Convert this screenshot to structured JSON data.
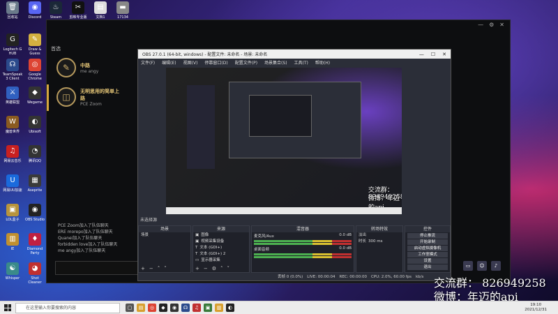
{
  "desktop": {
    "icons": [
      {
        "label": "回收站",
        "glyph": "🗑",
        "color": "#6a7a8a"
      },
      {
        "label": "Discord",
        "glyph": "◉",
        "color": "#5865f2"
      },
      {
        "label": "Steam",
        "glyph": "♨",
        "color": "#1b2838"
      },
      {
        "label": "剪映专业版",
        "glyph": "✂",
        "color": "#111"
      },
      {
        "label": "文档1",
        "glyph": "▤",
        "color": "#ddd"
      },
      {
        "label": "17134",
        "glyph": "▬",
        "color": "#888"
      },
      {
        "label": "Logitech G HUB",
        "glyph": "G",
        "color": "#222"
      },
      {
        "label": "Draw & Guess",
        "glyph": "✎",
        "color": "#d4b040"
      },
      {
        "label": "TeamSpeak 3 Client",
        "glyph": "☊",
        "color": "#2b4a8c"
      },
      {
        "label": "Google Chrome",
        "glyph": "◎",
        "color": "#dd4433"
      },
      {
        "label": "英雄联盟",
        "glyph": "⚔",
        "color": "#3060c0"
      },
      {
        "label": "Wegame",
        "glyph": "◆",
        "color": "#333"
      },
      {
        "label": "魔兽世界",
        "glyph": "W",
        "color": "#8a5a20"
      },
      {
        "label": "Ubisoft",
        "glyph": "◐",
        "color": "#333"
      },
      {
        "label": "网易云音乐",
        "glyph": "♫",
        "color": "#c82020"
      },
      {
        "label": "腾讯QQ",
        "glyph": "◔",
        "color": "#333"
      },
      {
        "label": "网易UU加速",
        "glyph": "U",
        "color": "#1a6adc"
      },
      {
        "label": "Aseprite",
        "glyph": "▦",
        "color": "#3a3a3a"
      },
      {
        "label": "LOL盒子",
        "glyph": "▣",
        "color": "#b8943c"
      },
      {
        "label": "OBS Studio",
        "glyph": "◉",
        "color": "#222"
      },
      {
        "label": "IE",
        "glyph": "▥",
        "color": "#c09030"
      },
      {
        "label": "Diamond Party",
        "glyph": "♦",
        "color": "#c02040"
      },
      {
        "label": "Whisper",
        "glyph": "☯",
        "color": "#3a8a8a"
      },
      {
        "label": "Shot Cleaner",
        "glyph": "◕",
        "color": "#c03030"
      }
    ]
  },
  "app": {
    "title": "首选",
    "controls": [
      "—",
      "⚙",
      "✕"
    ],
    "nav": [
      {
        "title": "中路",
        "subtitle": "me angy",
        "glyph": "✎"
      },
      {
        "title": "无明思用的简单上路",
        "subtitle": "PCE Zoom",
        "glyph": "◫"
      }
    ],
    "chat": [
      "PCE Zoom加入了队伍聊天",
      "ERE morepo加入了队伍聊天",
      "Quanei加入了队伍聊天",
      "forbidden love加入了队伍聊天",
      "me angy加入了队伍聊天"
    ]
  },
  "obs": {
    "title": "OBS 27.0.1 (64-bit, windows) - 配置文件: 未命名 - 场景: 未命名",
    "title_controls": [
      "—",
      "☐",
      "✕"
    ],
    "menu": [
      "文件(F)",
      "编辑(E)",
      "视图(V)",
      "停靠窗口(D)",
      "配置文件(P)",
      "场景集合(S)",
      "工具(T)",
      "帮助(H)"
    ],
    "status_strip": "未选择源",
    "docks": {
      "scenes": {
        "header": "场景",
        "items": [
          "场景"
        ]
      },
      "sources": {
        "header": "来源",
        "items": [
          "图像",
          "视频采集设备",
          "文本 (GDI+)",
          "文本 (GDI+) 2",
          "显示器采集"
        ]
      },
      "mixer": {
        "header": "混音器",
        "channels": [
          {
            "name": "麦克风/Aux",
            "db": "0.0 dB"
          },
          {
            "name": "桌面音频",
            "db": "0.0 dB"
          }
        ]
      },
      "transitions": {
        "header": "转场特效",
        "type": "淡出",
        "duration_label": "时长",
        "duration": "300 ms"
      },
      "controls": {
        "header": "控件",
        "buttons": [
          "停止推流",
          "开始录制",
          "启动虚拟摄像机",
          "工作室模式",
          "设置",
          "退出"
        ]
      }
    },
    "bottom_status": [
      "丢帧 0 (0.0%)",
      "LIVE: 00:00:04",
      "REC: 00:00:00",
      "CPU: 2.0%, 60.00 fps",
      "kb/s"
    ]
  },
  "overlay": {
    "qq_group": "交流群：  826949258",
    "weibo": "微博：年迈的api"
  },
  "watermark": {
    "qq_group": "交流群：  826949258",
    "weibo": "微博：年迈的api"
  },
  "taskbar": {
    "search_placeholder": "在这里输入你要搜索的内容",
    "time": "19:10",
    "date": "2021/12/31"
  }
}
